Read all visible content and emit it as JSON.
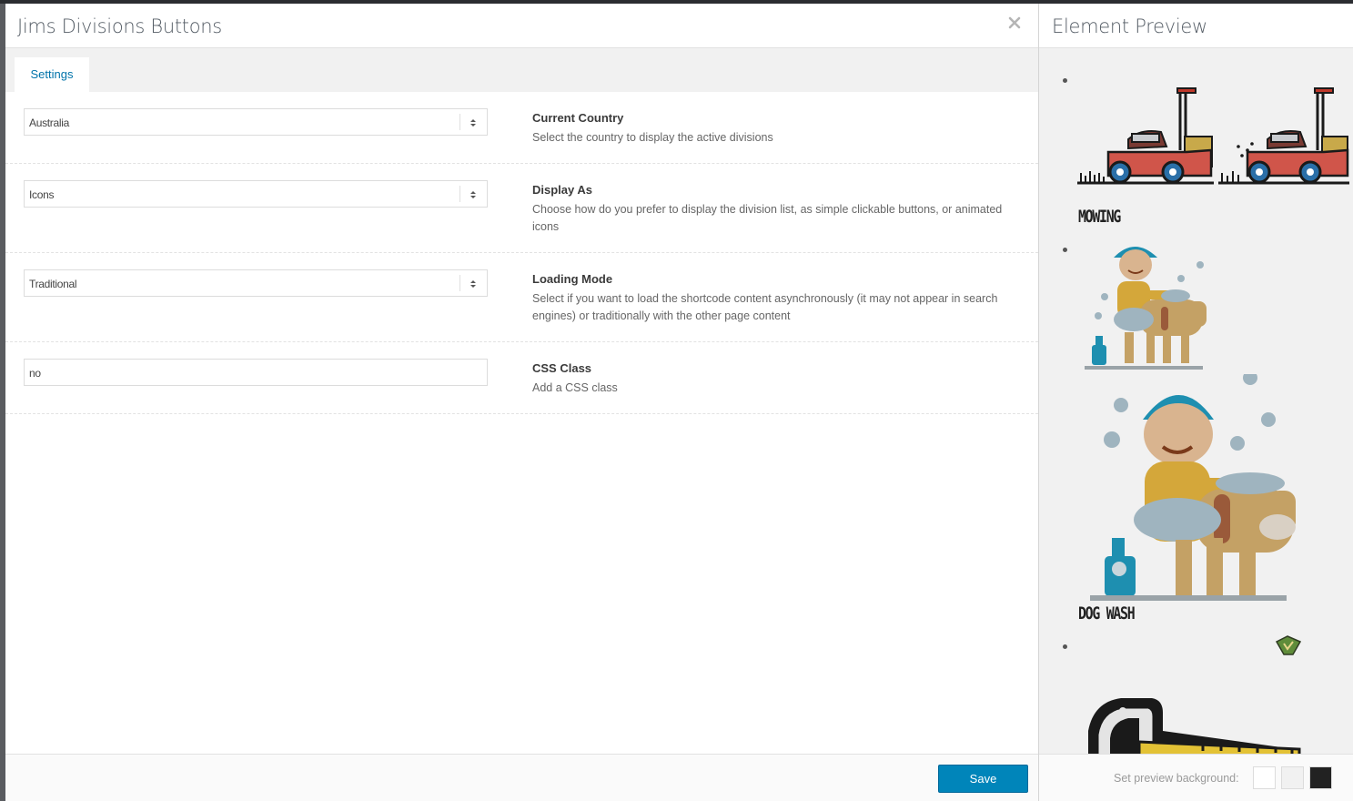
{
  "modal": {
    "title": "Jims Divisions Buttons",
    "close_icon": "close-icon",
    "tabs": [
      {
        "label": "Settings",
        "active": true
      }
    ],
    "fields": {
      "country": {
        "value": "Australia",
        "label": "Current Country",
        "description": "Select the country to display the active divisions"
      },
      "display_as": {
        "value": "Icons",
        "label": "Display As",
        "description": "Choose how do you prefer to display the division list, as simple clickable buttons, or animated icons"
      },
      "loading_mode": {
        "value": "Traditional",
        "label": "Loading Mode",
        "description": "Select if you want to load the shortcode content asynchronously (it may not appear in search engines) or traditionally with the other page content"
      },
      "css_class": {
        "value": "no",
        "label": "CSS Class",
        "description": "Add a CSS class"
      }
    },
    "save_label": "Save"
  },
  "preview": {
    "title": "Element Preview",
    "divisions": [
      {
        "label": "MOWING",
        "icon": "lawn-mower-icon"
      },
      {
        "label": "DOG WASH",
        "icon": "dog-wash-icon"
      },
      {
        "label": "",
        "icon": "lawn-mower-icon"
      }
    ],
    "background_label": "Set preview background:",
    "background_swatches": [
      "#ffffff",
      "#f1f1f1",
      "#222222"
    ]
  },
  "colors": {
    "accent": "#0085ba",
    "tab_text": "#0073aa"
  }
}
